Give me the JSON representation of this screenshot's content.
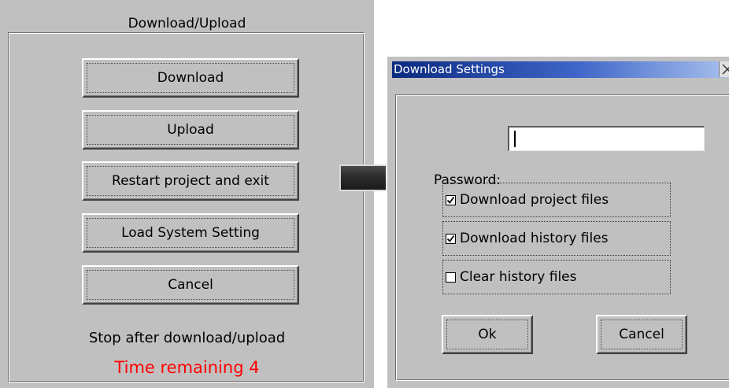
{
  "left_panel": {
    "title": "Download/Upload",
    "buttons": [
      {
        "label": "Download"
      },
      {
        "label": "Upload"
      },
      {
        "label": "Restart project and exit"
      },
      {
        "label": "Load System Setting"
      },
      {
        "label": "Cancel"
      }
    ],
    "stop_text": "Stop after download/upload",
    "time_remaining": "Time remaining 4"
  },
  "arrow": {
    "icon": "right-arrow-icon"
  },
  "dialog": {
    "title": "Download Settings",
    "close_icon": "close-icon",
    "password": {
      "label": "Password:",
      "value": ""
    },
    "options": [
      {
        "label": "Download project files",
        "checked": true
      },
      {
        "label": "Download history files",
        "checked": true
      },
      {
        "label": "Clear history files",
        "checked": false
      }
    ],
    "ok_label": "Ok",
    "cancel_label": "Cancel"
  },
  "colors": {
    "panel_bg": "#c0c0c0",
    "title_bar_start": "#0a2a80",
    "title_bar_end": "#a9c1ee",
    "timer_text": "#ff0000"
  }
}
